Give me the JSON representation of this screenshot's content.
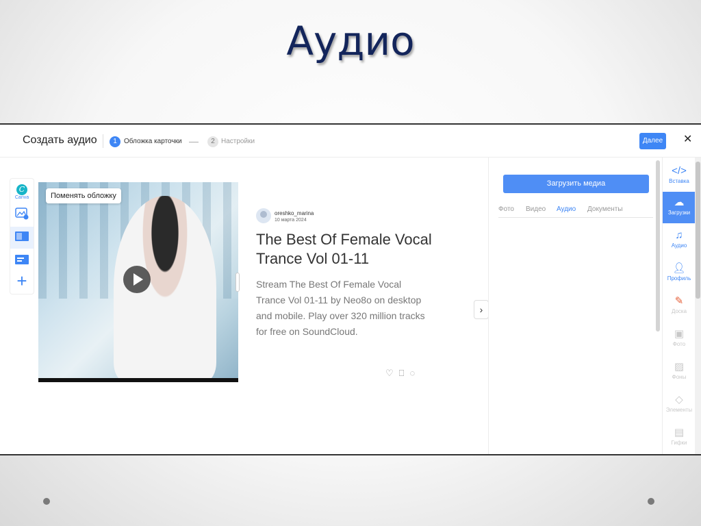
{
  "slide": {
    "title": "Аудио"
  },
  "header": {
    "title": "Создать аудио",
    "steps": [
      {
        "num": "1",
        "label": "Обложка карточки"
      },
      {
        "num": "2",
        "label": "Настройки"
      }
    ],
    "next_label": "Далее",
    "close": "✕"
  },
  "left_tools": {
    "canva_label": "Canva"
  },
  "card": {
    "change_cover_label": "Поменять обложку",
    "author_name": "oreshko_marina",
    "date": "10 марта 2024",
    "title": "The Best Of Female Vocal Trance Vol 01-11",
    "description": "Stream The Best Of Female Vocal Trance Vol 01-11 by Neo8o on desktop and mobile. Play over 320 million tracks for free on SoundCloud."
  },
  "right_panel": {
    "upload_label": "Загрузить медиа",
    "tabs": [
      "Фото",
      "Видео",
      "Аудио",
      "Документы"
    ]
  },
  "sidebar": [
    {
      "label": "Вставка",
      "icon": "code-icon"
    },
    {
      "label": "Загрузки",
      "icon": "upload-cloud-icon"
    },
    {
      "label": "Аудио",
      "icon": "music-note-icon"
    },
    {
      "label": "Профиль",
      "icon": "user-icon"
    },
    {
      "label": "Доска",
      "icon": "brush-icon"
    },
    {
      "label": "Фото",
      "icon": "image-icon"
    },
    {
      "label": "Фоны",
      "icon": "pattern-icon"
    },
    {
      "label": "Элементы",
      "icon": "shapes-icon"
    },
    {
      "label": "Гифки",
      "icon": "gif-icon"
    }
  ],
  "colors": {
    "accent": "#3e86f5",
    "title": "#13255b"
  }
}
